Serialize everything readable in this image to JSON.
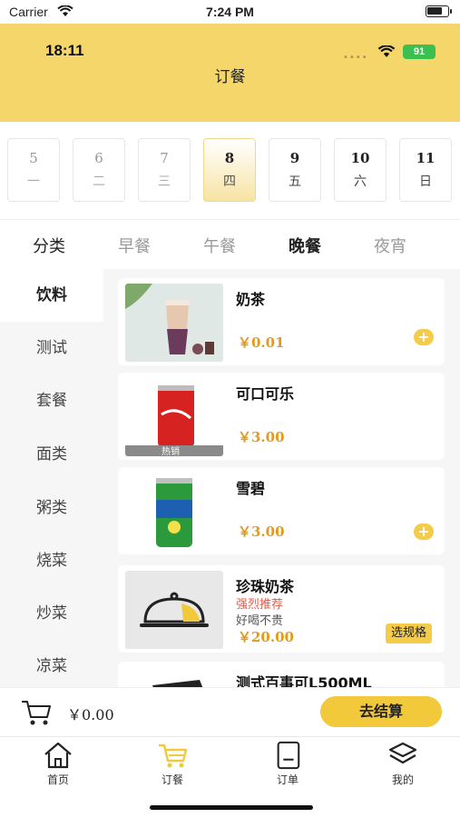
{
  "status_bar": {
    "carrier": "Carrier",
    "time": "7:24 PM"
  },
  "header": {
    "inner_time": "18:11",
    "battery": "91",
    "title": "订餐"
  },
  "dates": [
    {
      "day": "5",
      "weekday": "一"
    },
    {
      "day": "6",
      "weekday": "二"
    },
    {
      "day": "7",
      "weekday": "三"
    },
    {
      "day": "8",
      "weekday": "四",
      "selected": true
    },
    {
      "day": "9",
      "weekday": "五"
    },
    {
      "day": "10",
      "weekday": "六"
    },
    {
      "day": "11",
      "weekday": "日"
    }
  ],
  "meal_tabs": {
    "label": "分类",
    "items": [
      "早餐",
      "午餐",
      "晚餐",
      "夜宵"
    ],
    "active": "晚餐"
  },
  "categories": [
    "饮料",
    "测试",
    "套餐",
    "面类",
    "粥类",
    "烧菜",
    "炒菜",
    "凉菜"
  ],
  "active_category": "饮料",
  "products": [
    {
      "name": "奶茶",
      "price": "￥0.01",
      "image": "milk-tea",
      "action": "add"
    },
    {
      "name": "可口可乐",
      "price": "￥3.00",
      "image": "coca-cola-can",
      "image_caption": "热销"
    },
    {
      "name": "雪碧",
      "price": "￥3.00",
      "image": "sprite-can",
      "action": "add"
    },
    {
      "name": "珍珠奶茶",
      "tag": "强烈推荐",
      "desc": "好喝不贵",
      "price": "￥20.00",
      "image": "food-cloche-placeholder",
      "action_label": "选规格"
    },
    {
      "name": "测式百事可L500ML",
      "image": "pepsi-bottle"
    }
  ],
  "cart": {
    "total": "￥0.00",
    "checkout_label": "去结算"
  },
  "tabbar": [
    {
      "label": "首页",
      "icon": "home-icon"
    },
    {
      "label": "订餐",
      "icon": "cart-icon",
      "active": true
    },
    {
      "label": "订单",
      "icon": "order-icon"
    },
    {
      "label": "我的",
      "icon": "profile-icon"
    }
  ],
  "colors": {
    "accent": "#f4d66a",
    "button": "#f1c93b",
    "price": "#e49a18",
    "tag": "#e45a4a"
  }
}
